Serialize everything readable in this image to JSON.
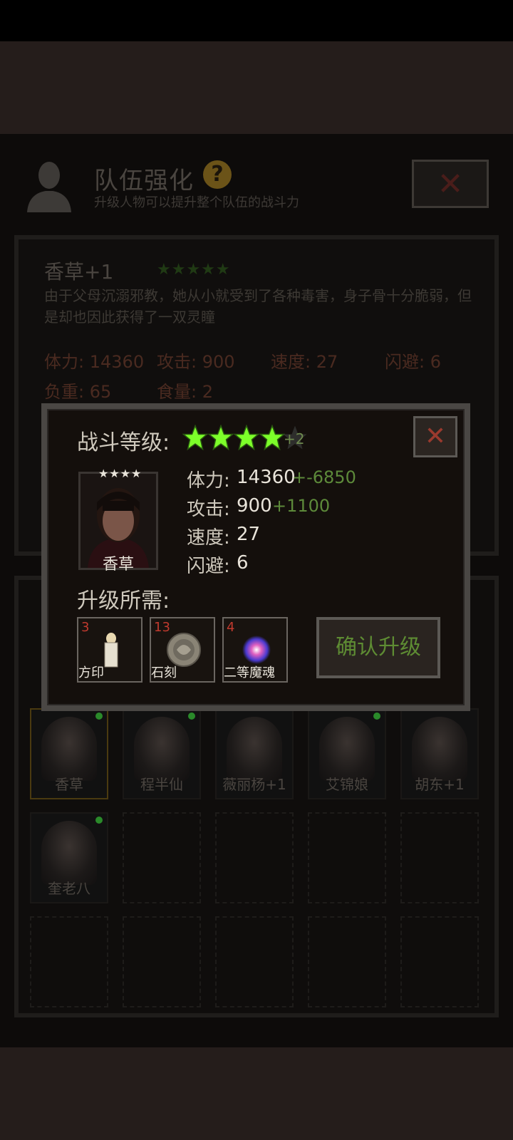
{
  "header": {
    "title": "队伍强化",
    "help": "?",
    "subtitle": "升级人物可以提升整个队伍的战斗力"
  },
  "character_info": {
    "name": "香草+1",
    "stars": "★★★★★",
    "description": "由于父母沉溺邪教，她从小就受到了各种毒害，身子骨十分脆弱，但是却也因此获得了一双灵瞳",
    "stats": [
      {
        "label": "体力:",
        "value": "14360"
      },
      {
        "label": "攻击:",
        "value": "900"
      },
      {
        "label": "速度:",
        "value": "27"
      },
      {
        "label": "闪避:",
        "value": "6"
      },
      {
        "label": "负重:",
        "value": "65"
      },
      {
        "label": "食量:",
        "value": "2"
      }
    ]
  },
  "roster": [
    {
      "name": "香草",
      "selected": true,
      "active": true
    },
    {
      "name": "程半仙",
      "active": true
    },
    {
      "name": "薇丽杨+1",
      "active": false
    },
    {
      "name": "艾锦娘",
      "active": true
    },
    {
      "name": "胡东+1",
      "active": false
    },
    {
      "name": "奎老八",
      "active": true
    }
  ],
  "modal": {
    "level_label": "战斗等级:",
    "stars_filled": 4,
    "level_bonus": "+2",
    "close_icon": "✕",
    "portrait": {
      "stars": "★★★★",
      "name": "香草"
    },
    "stats": [
      {
        "label": "体力:",
        "value": "14360",
        "delta": "+-6850"
      },
      {
        "label": "攻击:",
        "value": "900",
        "delta": "+1100"
      },
      {
        "label": "速度:",
        "value": "27",
        "delta": ""
      },
      {
        "label": "闪避:",
        "value": "6",
        "delta": ""
      }
    ],
    "requirements_label": "升级所需:",
    "items": [
      {
        "count": "3",
        "name": "方印",
        "icon": "seal-icon"
      },
      {
        "count": "13",
        "name": "石刻",
        "icon": "stone-carving-icon"
      },
      {
        "count": "4",
        "name": "二等魔魂",
        "icon": "soul-orb-icon"
      }
    ],
    "confirm_label": "确认升级"
  },
  "colors": {
    "accent_green": "#5e8c33",
    "count_red": "#c03a2e",
    "star_green": "#7dff2a"
  }
}
